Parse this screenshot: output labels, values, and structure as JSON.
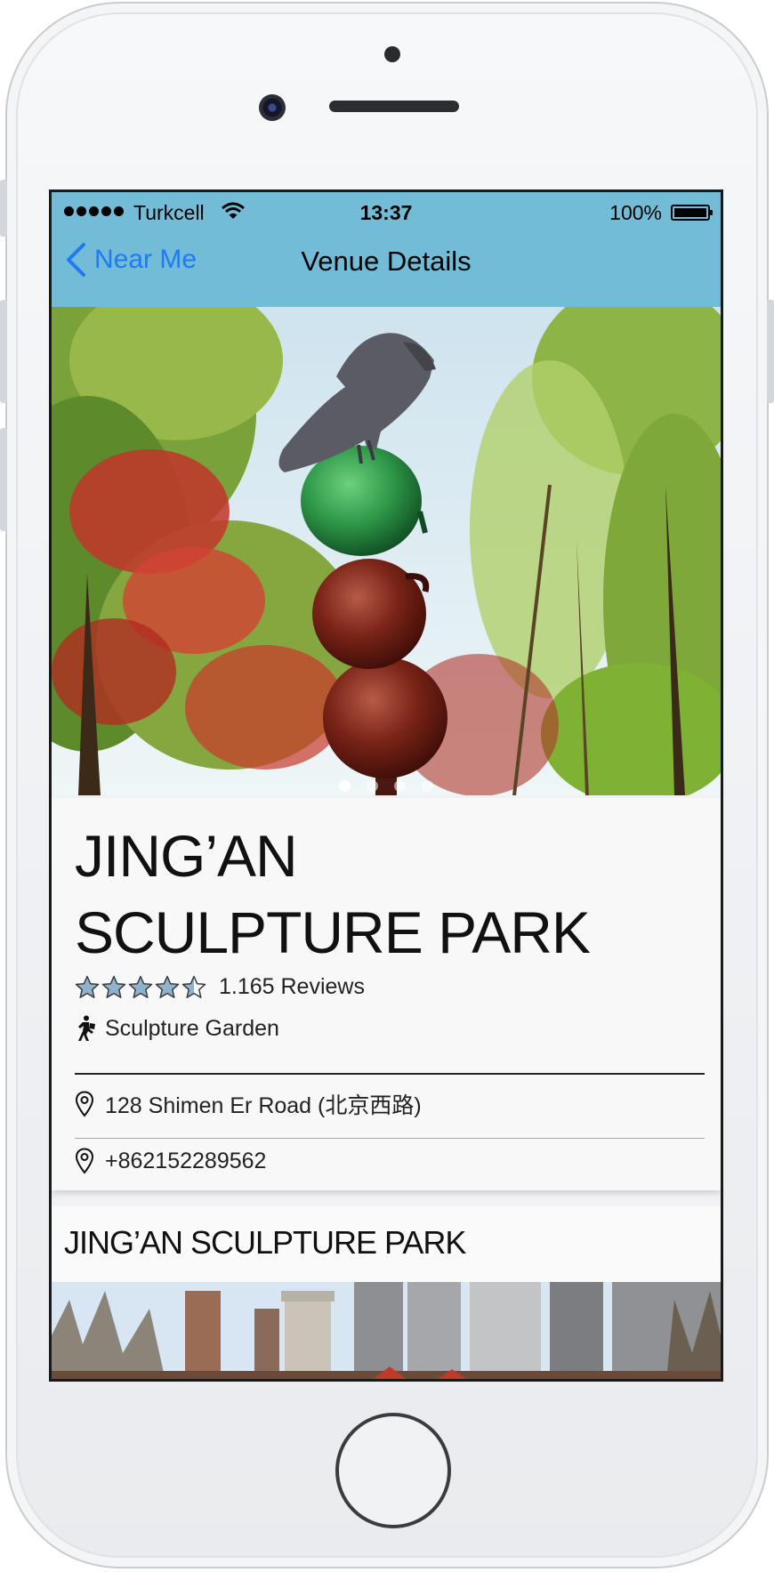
{
  "status_bar": {
    "carrier": "Turkcell",
    "time": "13:37",
    "battery": "100%",
    "signal_icon": "signal-dots-icon",
    "wifi_icon": "wifi-icon",
    "battery_icon": "battery-icon"
  },
  "nav": {
    "back_label": "Near Me",
    "title": "Venue Details",
    "back_icon": "chevron-left-icon"
  },
  "gallery": {
    "page_count": 4,
    "current_page": 1
  },
  "venue": {
    "name_line1": "JING’AN",
    "name_line2": "SCULPTURE PARK",
    "rating": 4.5,
    "rating_max": 5,
    "reviews": "1.165 Reviews",
    "category": "Sculpture Garden",
    "address": "128 Shimen Er Road (北京西路)",
    "phone": "+862152289562"
  },
  "section2": {
    "title": "JING’AN SCULPTURE PARK"
  },
  "colors": {
    "navbar": "#72bcd8",
    "tint": "#1e7af5",
    "star_fill": "#8fb3cc"
  }
}
